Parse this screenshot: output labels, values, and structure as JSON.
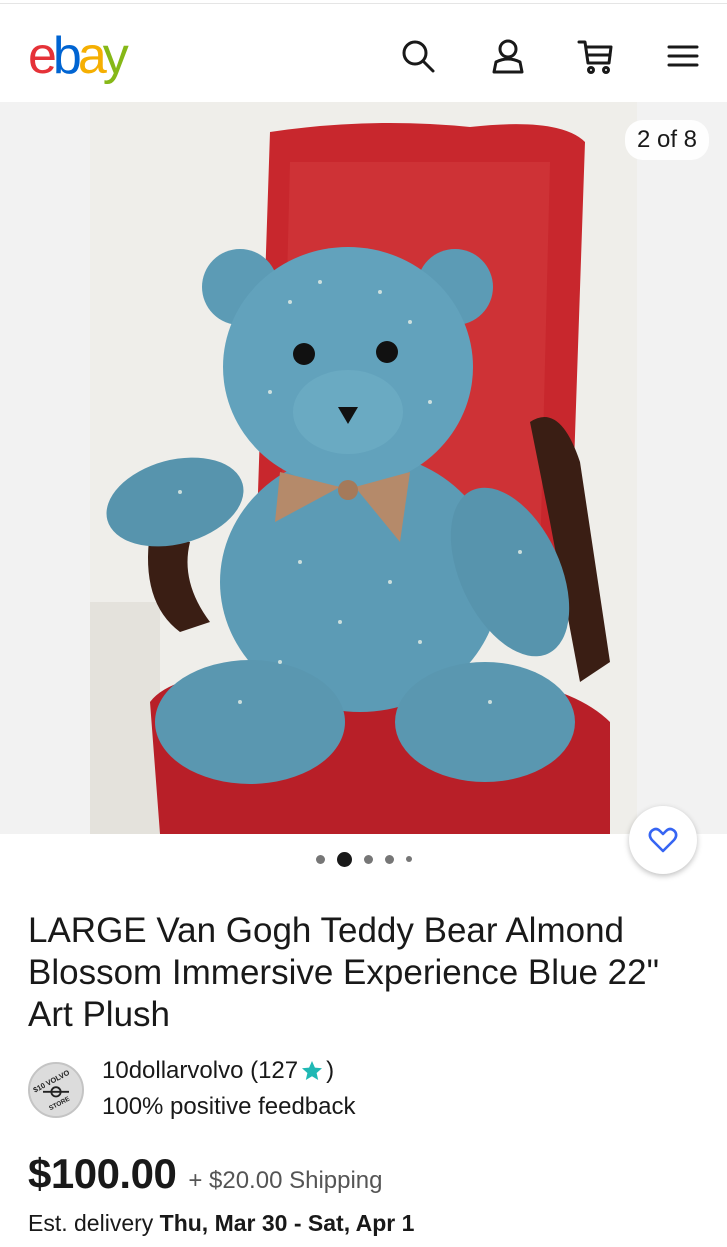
{
  "header": {
    "logo": {
      "e": "e",
      "b": "b",
      "a": "a",
      "y": "y"
    },
    "icons": [
      "search-icon",
      "user-icon",
      "cart-icon",
      "menu-icon"
    ]
  },
  "gallery": {
    "counter": "2 of 8",
    "dots_count": 5,
    "active_dot": 1,
    "photo_description_colors": {
      "chair": "#c8272d",
      "bear": "#5c9bb5",
      "wall": "#efeeea"
    }
  },
  "item": {
    "title": "LARGE Van Gogh Teddy Bear Almond Blossom Immersive Experience Blue 22\" Art Plush"
  },
  "seller": {
    "name": "10dollarvolvo",
    "score_open": "(127",
    "score_close": ")",
    "feedback": "100% positive feedback",
    "star_color": "#1fb8b4",
    "avatar_top": "$10 VOLVO",
    "avatar_bottom": "STORE"
  },
  "pricing": {
    "price": "$100.00",
    "shipping": "+ $20.00 Shipping"
  },
  "delivery": {
    "label": "Est. delivery",
    "range": "Thu, Mar 30 - Sat, Apr 1"
  }
}
